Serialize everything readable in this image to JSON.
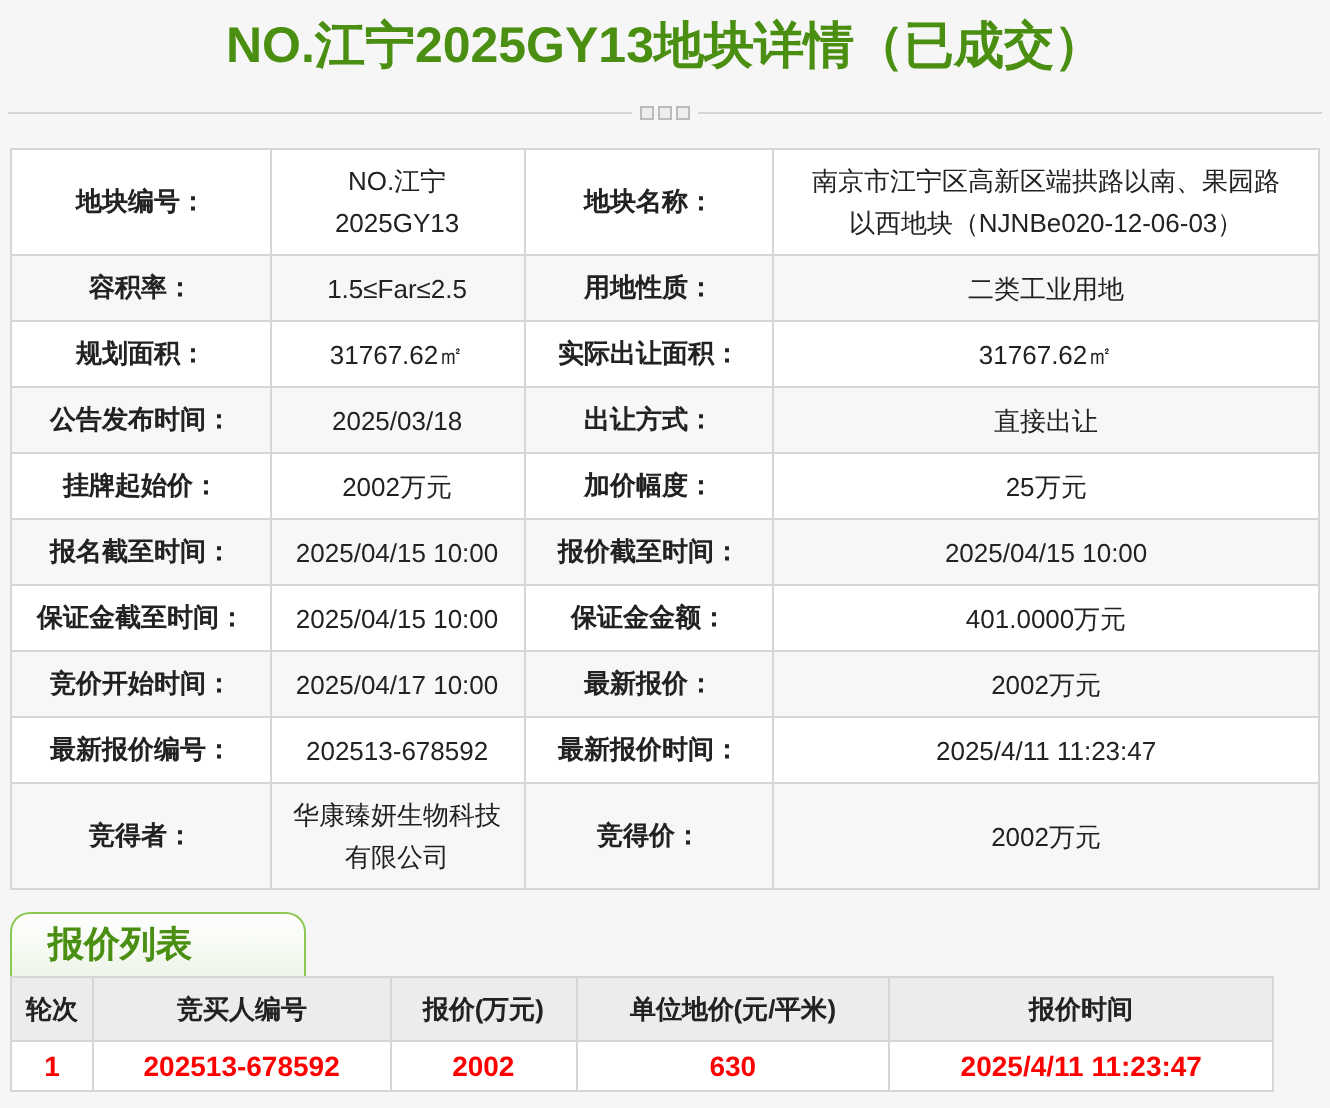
{
  "title": "NO.江宁2025GY13地块详情（已成交）",
  "details": [
    [
      {
        "label": "地块编号：",
        "value": "NO.江宁2025GY13"
      },
      {
        "label": "地块名称：",
        "value": "南京市江宁区高新区端拱路以南、果园路以西地块（NJNBe020-12-06-03）"
      }
    ],
    [
      {
        "label": "容积率：",
        "value": "1.5≤Far≤2.5"
      },
      {
        "label": "用地性质：",
        "value": "二类工业用地"
      }
    ],
    [
      {
        "label": "规划面积：",
        "value": "31767.62㎡"
      },
      {
        "label": "实际出让面积：",
        "value": "31767.62㎡"
      }
    ],
    [
      {
        "label": "公告发布时间：",
        "value": "2025/03/18"
      },
      {
        "label": "出让方式：",
        "value": "直接出让"
      }
    ],
    [
      {
        "label": "挂牌起始价：",
        "value": "2002万元"
      },
      {
        "label": "加价幅度：",
        "value": "25万元"
      }
    ],
    [
      {
        "label": "报名截至时间：",
        "value": "2025/04/15 10:00"
      },
      {
        "label": "报价截至时间：",
        "value": "2025/04/15 10:00"
      }
    ],
    [
      {
        "label": "保证金截至时间：",
        "value": "2025/04/15 10:00"
      },
      {
        "label": "保证金金额：",
        "value": "401.0000万元"
      }
    ],
    [
      {
        "label": "竞价开始时间：",
        "value": "2025/04/17 10:00"
      },
      {
        "label": "最新报价：",
        "value": "2002万元"
      }
    ],
    [
      {
        "label": "最新报价编号：",
        "value": "202513-678592"
      },
      {
        "label": "最新报价时间：",
        "value": "2025/4/11 11:23:47"
      }
    ],
    [
      {
        "label": "竞得者：",
        "value": "华康臻妍生物科技有限公司"
      },
      {
        "label": "竞得价：",
        "value": "2002万元"
      }
    ]
  ],
  "bid_list": {
    "tab": "报价列表",
    "columns": [
      "轮次",
      "竞买人编号",
      "报价(万元)",
      "单位地价(元/平米)",
      "报价时间"
    ],
    "rows": [
      [
        "1",
        "202513-678592",
        "2002",
        "630",
        "2025/4/11 11:23:47"
      ]
    ]
  }
}
